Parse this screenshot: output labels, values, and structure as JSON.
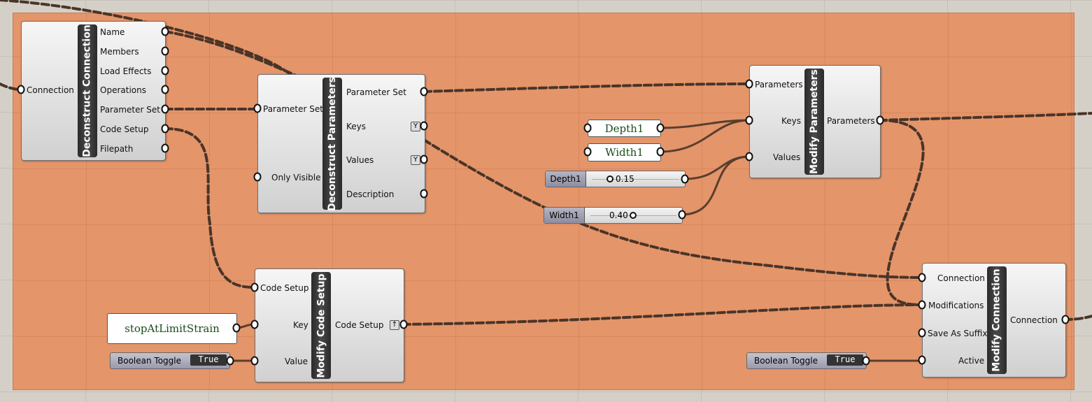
{
  "deconstruct_connection": {
    "title": "Deconstruct Connection",
    "inputs": [
      "Connection"
    ],
    "outputs": [
      "Name",
      "Members",
      "Load Effects",
      "Operations",
      "Parameter Set",
      "Code Setup",
      "Filepath"
    ]
  },
  "deconstruct_parameters": {
    "title": "Deconstruct Parameters",
    "inputs": [
      "Parameter Set",
      "Only Visible"
    ],
    "outputs": [
      "Parameter Set",
      "Keys",
      "Values",
      "Description"
    ],
    "filter_icon": "Y"
  },
  "modify_parameters": {
    "title": "Modify Parameters",
    "inputs": [
      "Parameters",
      "Keys",
      "Values"
    ],
    "outputs": [
      "Parameters"
    ]
  },
  "modify_code_setup": {
    "title": "Modify Code Setup",
    "inputs": [
      "Code Setup",
      "Key",
      "Value"
    ],
    "outputs": [
      "Code Setup"
    ],
    "graft_icon": "↑"
  },
  "modify_connection": {
    "title": "Modify Connection",
    "inputs": [
      "Connection",
      "Modifications",
      "Save As Suffix",
      "Active"
    ],
    "outputs": [
      "Connection"
    ]
  },
  "panels": {
    "depth": "Depth1",
    "width": "Width1",
    "key": "stopAtLimitStrain"
  },
  "sliders": [
    {
      "name": "Depth1",
      "value": "0.15",
      "fraction": 0.15
    },
    {
      "name": "Width1",
      "value": "0.40",
      "fraction": 0.4
    }
  ],
  "toggles": [
    {
      "label": "Boolean Toggle",
      "value": "True"
    },
    {
      "label": "Boolean Toggle",
      "value": "True"
    }
  ],
  "colors": {
    "group": "#e4956a",
    "wire": "#5a3e2e"
  }
}
